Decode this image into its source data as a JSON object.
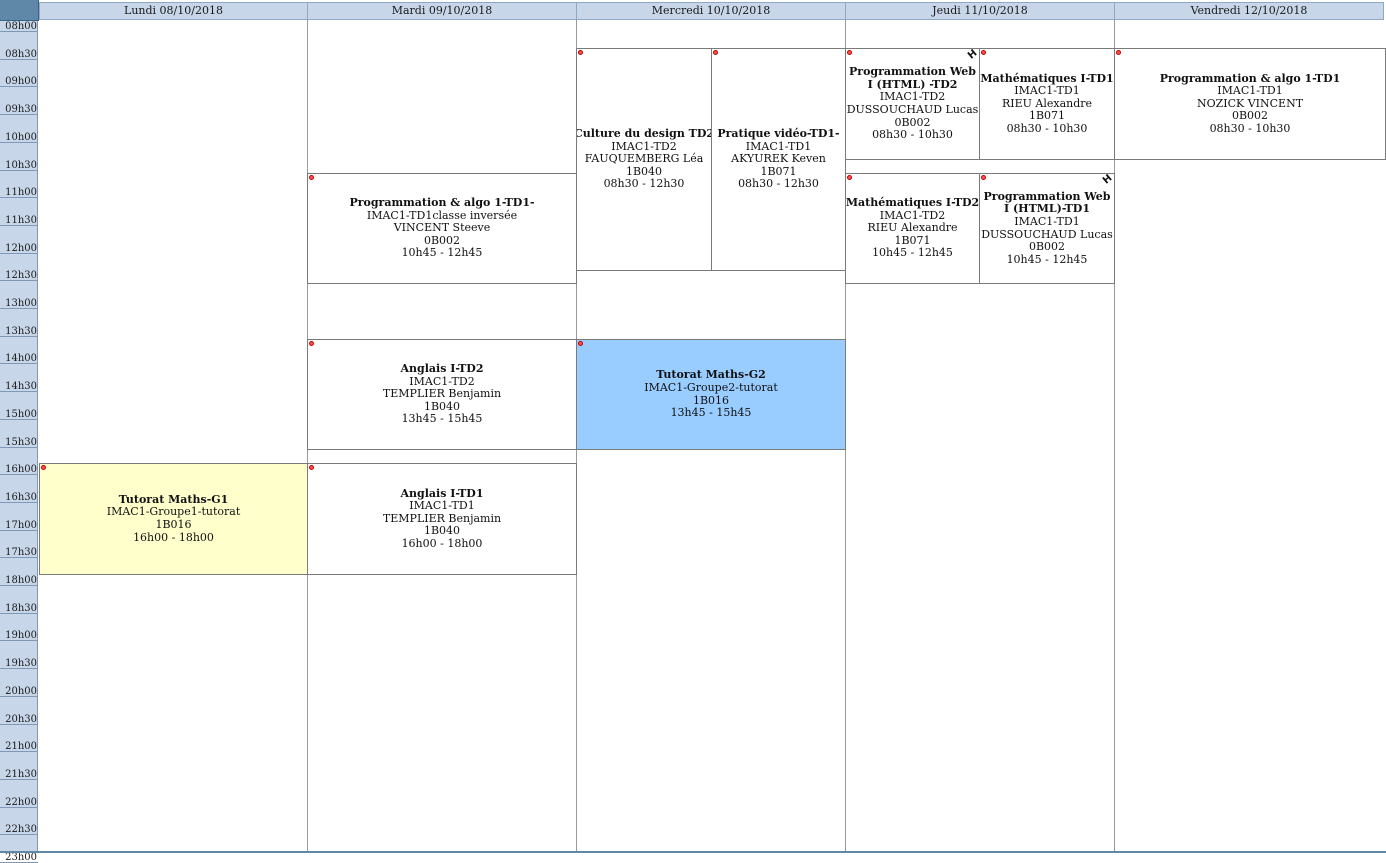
{
  "days": [
    {
      "label": "Lundi 08/10/2018"
    },
    {
      "label": "Mardi 09/10/2018"
    },
    {
      "label": "Mercredi 10/10/2018"
    },
    {
      "label": "Jeudi 11/10/2018"
    },
    {
      "label": "Vendredi 12/10/2018"
    }
  ],
  "times": [
    "08h00",
    "08h30",
    "09h00",
    "09h30",
    "10h00",
    "10h30",
    "11h00",
    "11h30",
    "12h00",
    "12h30",
    "13h00",
    "13h30",
    "14h00",
    "14h30",
    "15h00",
    "15h30",
    "16h00",
    "16h30",
    "17h00",
    "17h30",
    "18h00",
    "18h30",
    "19h00",
    "19h30",
    "20h00",
    "20h30",
    "21h00",
    "21h30",
    "22h00",
    "22h30",
    "23h00"
  ],
  "events": {
    "lun_tutorat": {
      "title": "Tutorat Maths-G1",
      "group": "IMAC1-Groupe1-tutorat",
      "room": "1B016",
      "time": "16h00 - 18h00",
      "color": "#ffffcc"
    },
    "mar_prog": {
      "title": "Programmation & algo 1-TD1-",
      "group": "IMAC1-TD1classe inversée",
      "teacher": "VINCENT Steeve",
      "room": "0B002",
      "time": "10h45 - 12h45",
      "color": "#ffffff"
    },
    "mar_anglais_td2": {
      "title": "Anglais I-TD2",
      "group": "IMAC1-TD2",
      "teacher": "TEMPLIER Benjamin",
      "room": "1B040",
      "time": "13h45 - 15h45",
      "color": "#ffffff"
    },
    "mar_anglais_td1": {
      "title": "Anglais I-TD1",
      "group": "IMAC1-TD1",
      "teacher": "TEMPLIER Benjamin",
      "room": "1B040",
      "time": "16h00 - 18h00",
      "color": "#ffffff"
    },
    "mer_culture": {
      "title": "Culture du design TD2",
      "group": "IMAC1-TD2",
      "teacher": "FAUQUEMBERG Léa",
      "room": "1B040",
      "time": "08h30 - 12h30",
      "color": "#ffffff"
    },
    "mer_video": {
      "title": "Pratique vidéo-TD1-",
      "group": "IMAC1-TD1",
      "teacher": "AKYUREK Keven",
      "room": "1B071",
      "time": "08h30 - 12h30",
      "color": "#ffffff"
    },
    "mer_tutorat": {
      "title": "Tutorat Maths-G2",
      "group": "IMAC1-Groupe2-tutorat",
      "room": "1B016",
      "time": "13h45 - 15h45",
      "color": "#99ccff"
    },
    "jeu_web_td2": {
      "title": "Programmation Web I (HTML) -TD2",
      "group": "IMAC1-TD2",
      "teacher": "DUSSOUCHAUD Lucas",
      "room": "0B002",
      "time": "08h30 - 10h30",
      "mark": "H",
      "color": "#ffffff"
    },
    "jeu_maths_td1": {
      "title": "Mathématiques I-TD1",
      "group": "IMAC1-TD1",
      "teacher": "RIEU Alexandre",
      "room": "1B071",
      "time": "08h30 - 10h30",
      "color": "#ffffff"
    },
    "jeu_maths_td2": {
      "title": "Mathématiques I-TD2",
      "group": "IMAC1-TD2",
      "teacher": "RIEU Alexandre",
      "room": "1B071",
      "time": "10h45 - 12h45",
      "color": "#ffffff"
    },
    "jeu_web_td1": {
      "title": "Programmation Web I (HTML)-TD1",
      "group": "IMAC1-TD1",
      "teacher": "DUSSOUCHAUD Lucas",
      "room": "0B002",
      "time": "10h45 - 12h45",
      "mark": "H",
      "color": "#ffffff"
    },
    "ven_prog": {
      "title": "Programmation & algo 1-TD1",
      "group": "IMAC1-TD1",
      "teacher": "NOZICK VINCENT",
      "room": "0B002",
      "time": "08h30 - 10h30",
      "color": "#ffffff"
    }
  }
}
